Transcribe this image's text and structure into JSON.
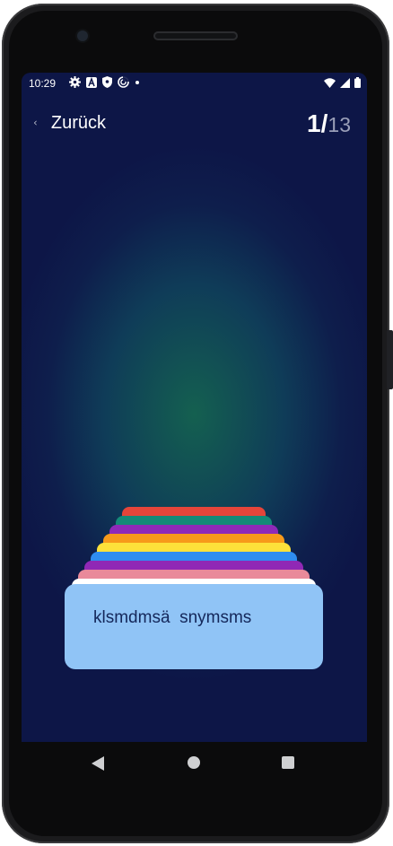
{
  "status_bar": {
    "time": "10:29",
    "icons": [
      "gear-icon",
      "font-icon",
      "shield-icon",
      "sync-icon",
      "dot-icon"
    ],
    "right_icons": [
      "wifi-icon",
      "signal-icon",
      "battery-icon"
    ]
  },
  "header": {
    "back_label": "Zurück",
    "current": "1/",
    "total": "13"
  },
  "card_stack": {
    "strip_colors": [
      "#e5453a",
      "#148a78",
      "#8e2ab8",
      "#f79a1a",
      "#fde13a",
      "#2f8df0",
      "#9028b5",
      "#e98a9a",
      "#ffffff"
    ],
    "card_color": "#90c4f6"
  },
  "card": {
    "text": "klsmdmsä  snymsms"
  },
  "nav_bar": {
    "buttons": [
      "back-triangle-icon",
      "home-circle-icon",
      "recents-square-icon"
    ]
  }
}
